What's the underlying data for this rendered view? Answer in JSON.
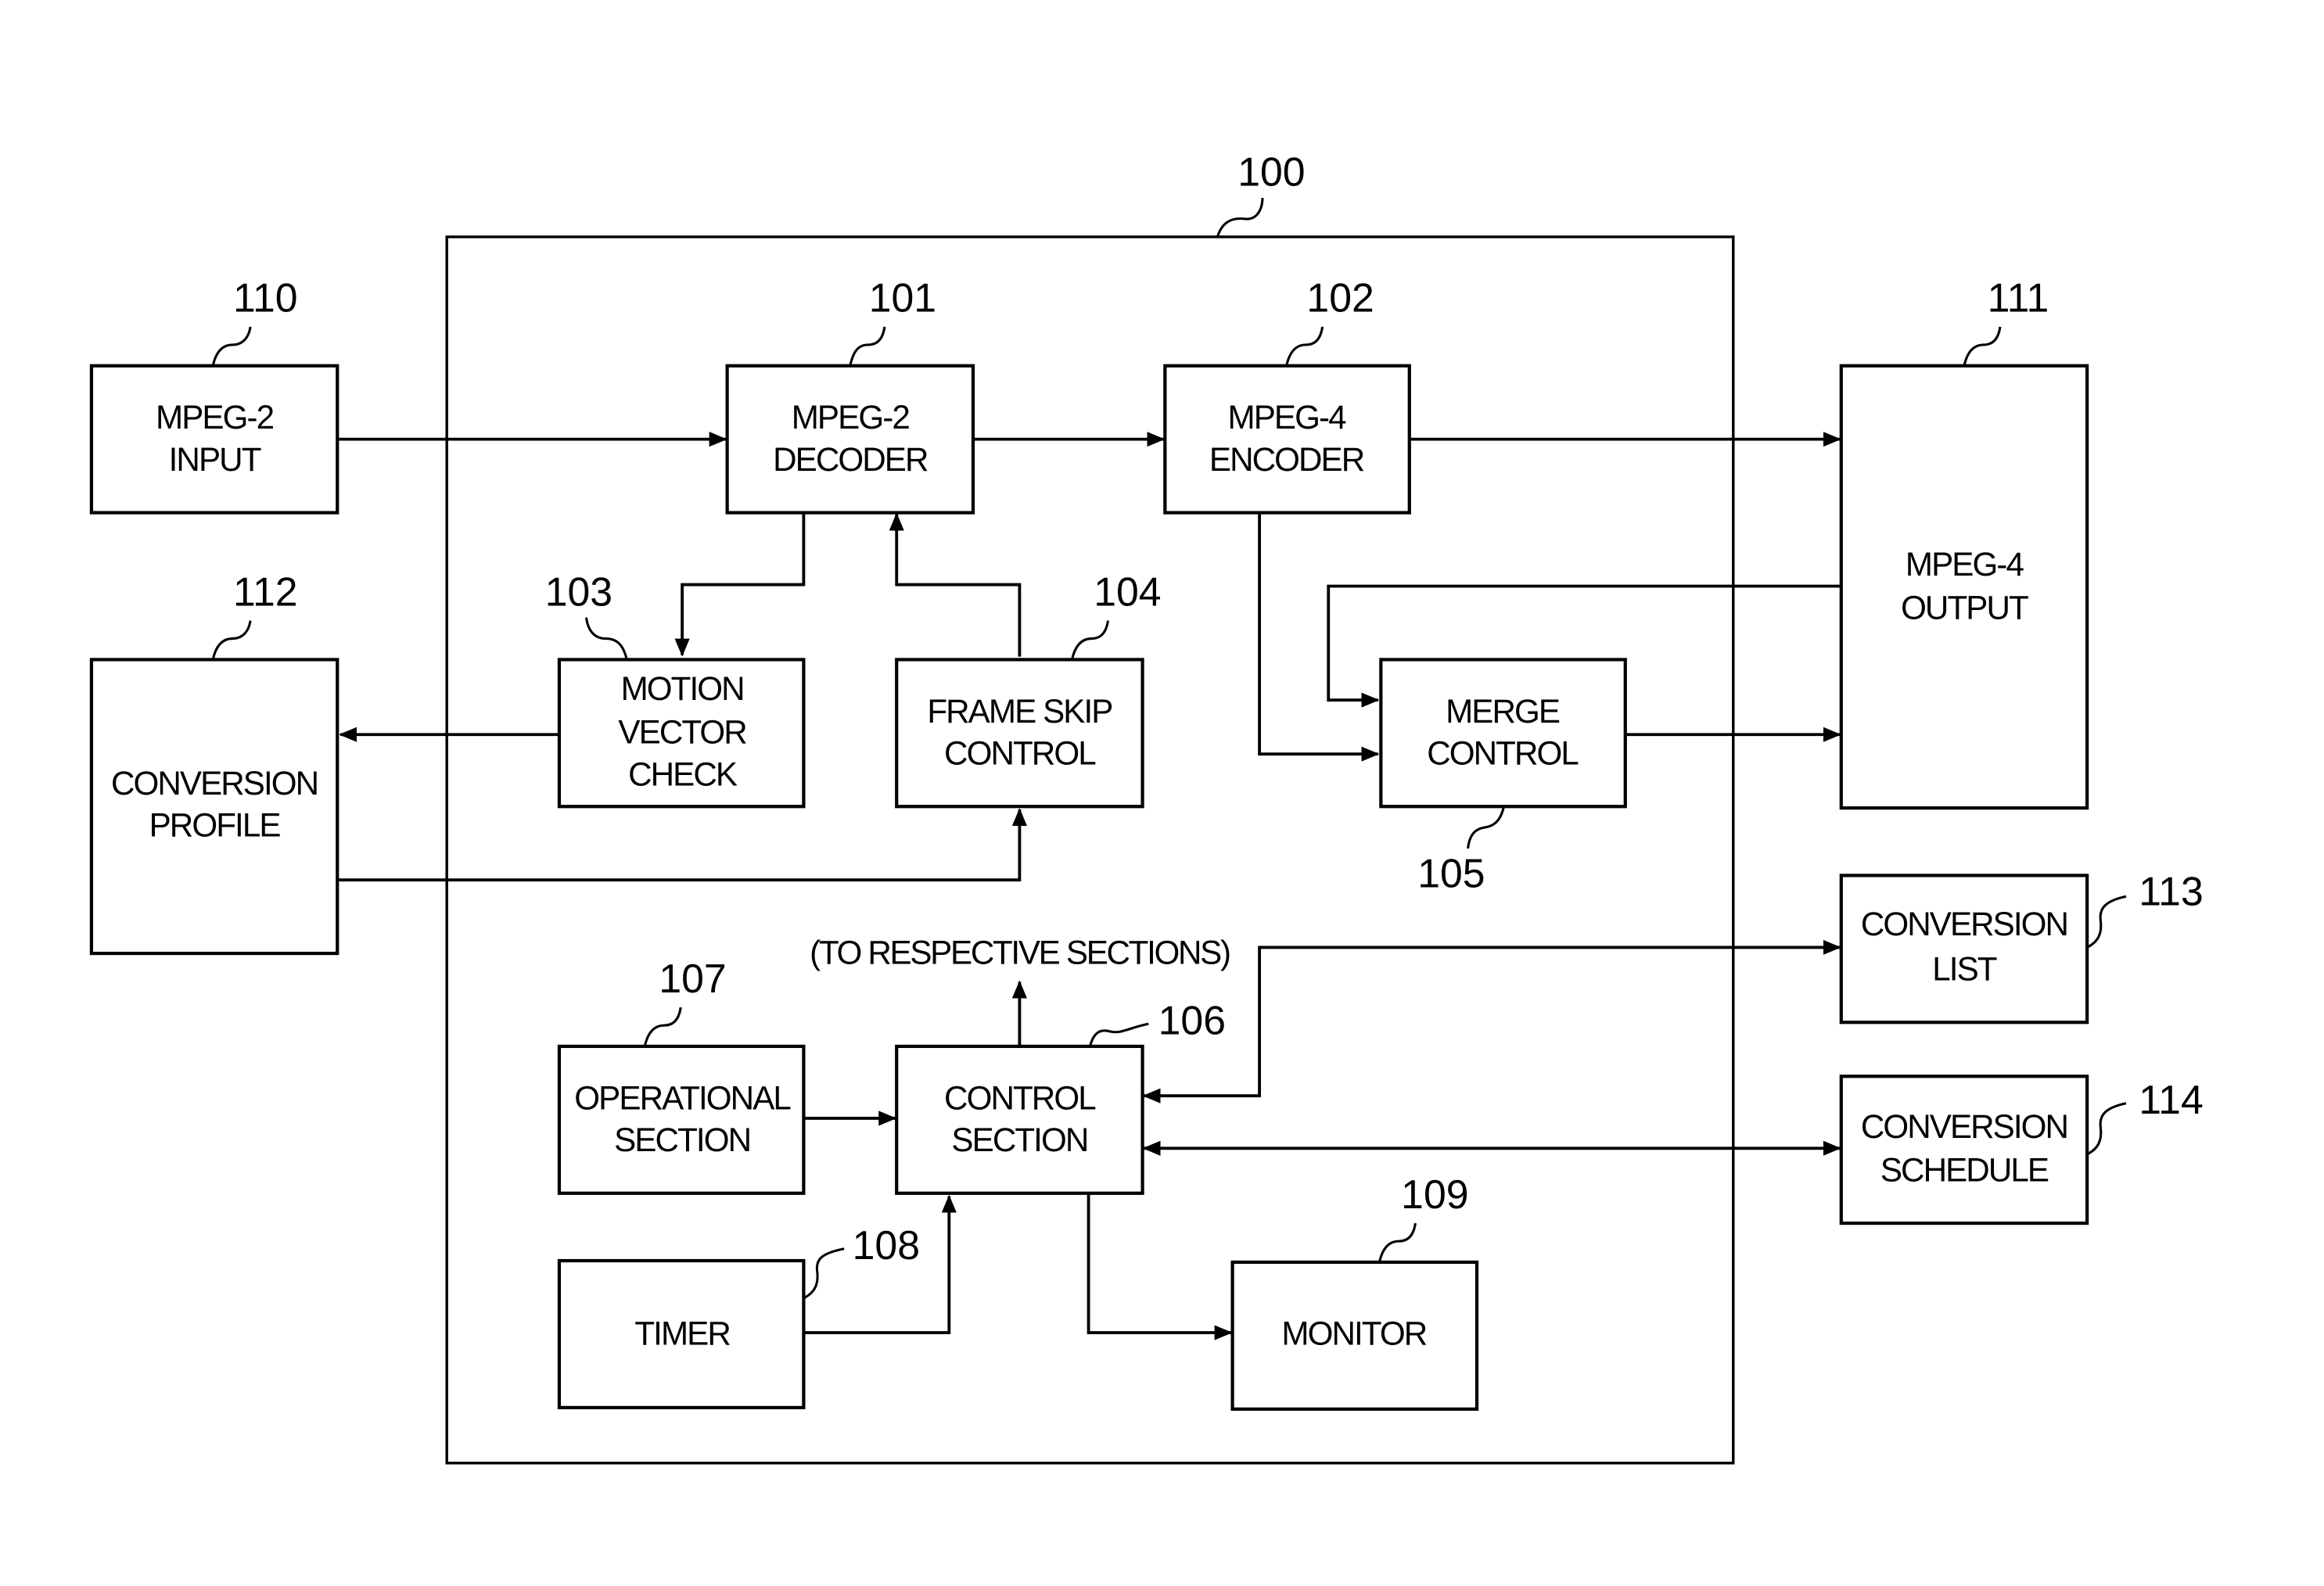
{
  "figure": {
    "system_ref": "100",
    "note": "(TO RESPECTIVE SECTIONS)",
    "blocks": {
      "mpeg2_input": {
        "ref": "110",
        "lines": [
          "MPEG-2",
          "INPUT"
        ]
      },
      "mpeg2_decoder": {
        "ref": "101",
        "lines": [
          "MPEG-2",
          "DECODER"
        ]
      },
      "mpeg4_encoder": {
        "ref": "102",
        "lines": [
          "MPEG-4",
          "ENCODER"
        ]
      },
      "mpeg4_output": {
        "ref": "111",
        "lines": [
          "MPEG-4",
          "OUTPUT"
        ]
      },
      "conversion_profile": {
        "ref": "112",
        "lines": [
          "CONVERSION",
          "PROFILE"
        ]
      },
      "motion_vector_check": {
        "ref": "103",
        "lines": [
          "MOTION",
          "VECTOR",
          "CHECK"
        ]
      },
      "frame_skip_control": {
        "ref": "104",
        "lines": [
          "FRAME SKIP",
          "CONTROL"
        ]
      },
      "merge_control": {
        "ref": "105",
        "lines": [
          "MERGE",
          "CONTROL"
        ]
      },
      "control_section": {
        "ref": "106",
        "lines": [
          "CONTROL",
          "SECTION"
        ]
      },
      "operational_section": {
        "ref": "107",
        "lines": [
          "OPERATIONAL",
          "SECTION"
        ]
      },
      "timer": {
        "ref": "108",
        "lines": [
          "TIMER"
        ]
      },
      "monitor": {
        "ref": "109",
        "lines": [
          "MONITOR"
        ]
      },
      "conversion_list": {
        "ref": "113",
        "lines": [
          "CONVERSION",
          "LIST"
        ]
      },
      "conversion_schedule": {
        "ref": "114",
        "lines": [
          "CONVERSION",
          "SCHEDULE"
        ]
      }
    }
  }
}
